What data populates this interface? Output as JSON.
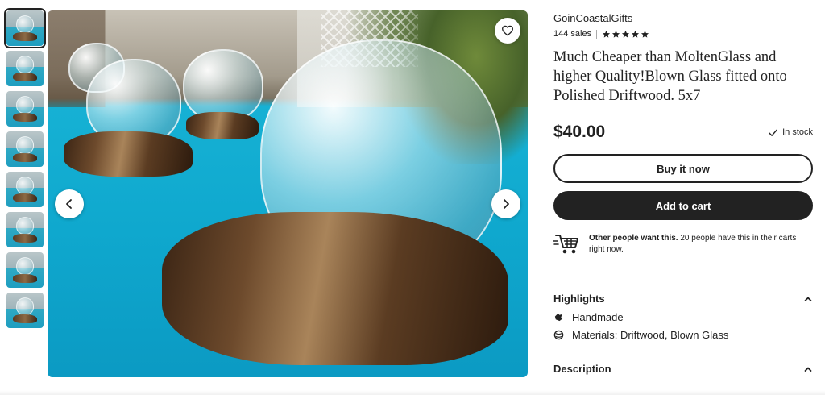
{
  "gallery": {
    "thumbnail_count": 8,
    "active_index": 0
  },
  "main_image": {
    "prev_icon": "chevron-left-icon",
    "next_icon": "chevron-right-icon",
    "favorite_icon": "heart-outline-icon"
  },
  "shop": {
    "name": "GoinCoastalGifts",
    "sales": "144 sales",
    "rating": 5
  },
  "listing": {
    "title": "Much Cheaper than MoltenGlass and higher Quality!Blown Glass fitted onto Polished Driftwood. 5x7",
    "price": "$40.00",
    "stock": "In stock"
  },
  "actions": {
    "buy_now": "Buy it now",
    "add_to_cart": "Add to cart"
  },
  "demand": {
    "bold": "Other people want this.",
    "rest": " 20 people have this in their carts right now."
  },
  "highlights": {
    "heading": "Highlights",
    "items": [
      {
        "icon": "hand-icon",
        "label": "Handmade"
      },
      {
        "icon": "materials-icon",
        "label": "Materials: Driftwood, Blown Glass"
      }
    ]
  },
  "description": {
    "heading": "Description"
  },
  "colors": {
    "text": "#222222",
    "button_dark": "#222222",
    "background": "#ffffff"
  }
}
